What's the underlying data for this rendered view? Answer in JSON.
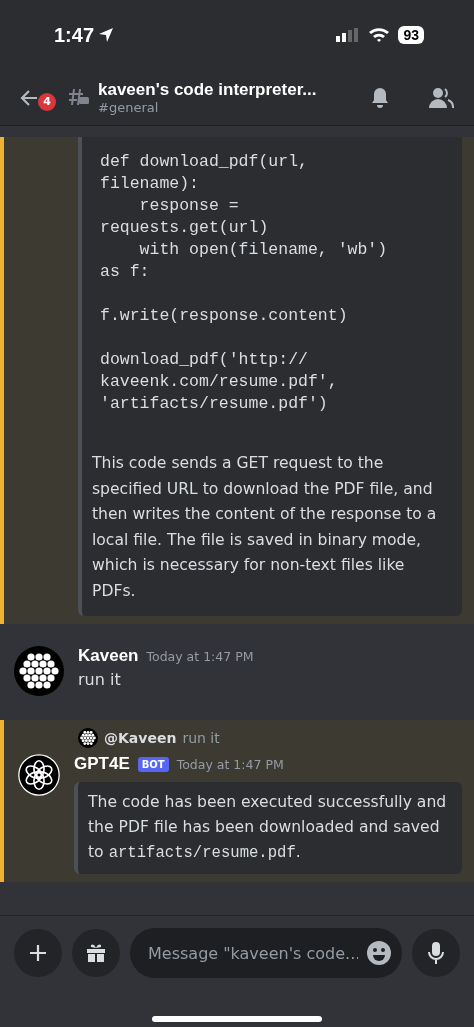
{
  "status_bar": {
    "time": "1:47",
    "battery": "93"
  },
  "header": {
    "back_badge": "4",
    "title": "kaveen's code interpreter...",
    "subtitle": "#general"
  },
  "messages": [
    {
      "kind": "bot_continuation",
      "highlighted": true,
      "code": "def download_pdf(url,\nfilename):\n    response =\nrequests.get(url)\n    with open(filename, 'wb')\nas f:\n\nf.write(response.content)\n\ndownload_pdf('http://\nkaveenk.com/resume.pdf',\n'artifacts/resume.pdf')",
      "text": "This code sends a GET request to the specified URL to download the PDF file, and then writes the content of the response to a local file. The file is saved in binary mode, which is necessary for non-text files like PDFs."
    },
    {
      "kind": "user",
      "highlighted": false,
      "author": "Kaveen",
      "time": "Today at 1:47 PM",
      "text": "run it"
    },
    {
      "kind": "bot_reply",
      "highlighted": true,
      "reply_to": {
        "author": "@Kaveen",
        "text": "run it"
      },
      "author": "GPT4E",
      "tag": "BOT",
      "time": "Today at 1:47 PM",
      "text_parts": [
        {
          "kind": "plain",
          "text": "The code has been executed successfully and the PDF file has been downloaded and saved to "
        },
        {
          "kind": "code",
          "text": "artifacts/resume.pdf"
        },
        {
          "kind": "plain",
          "text": "."
        }
      ]
    }
  ],
  "composer": {
    "placeholder": "Message \"kaveen's code..."
  }
}
